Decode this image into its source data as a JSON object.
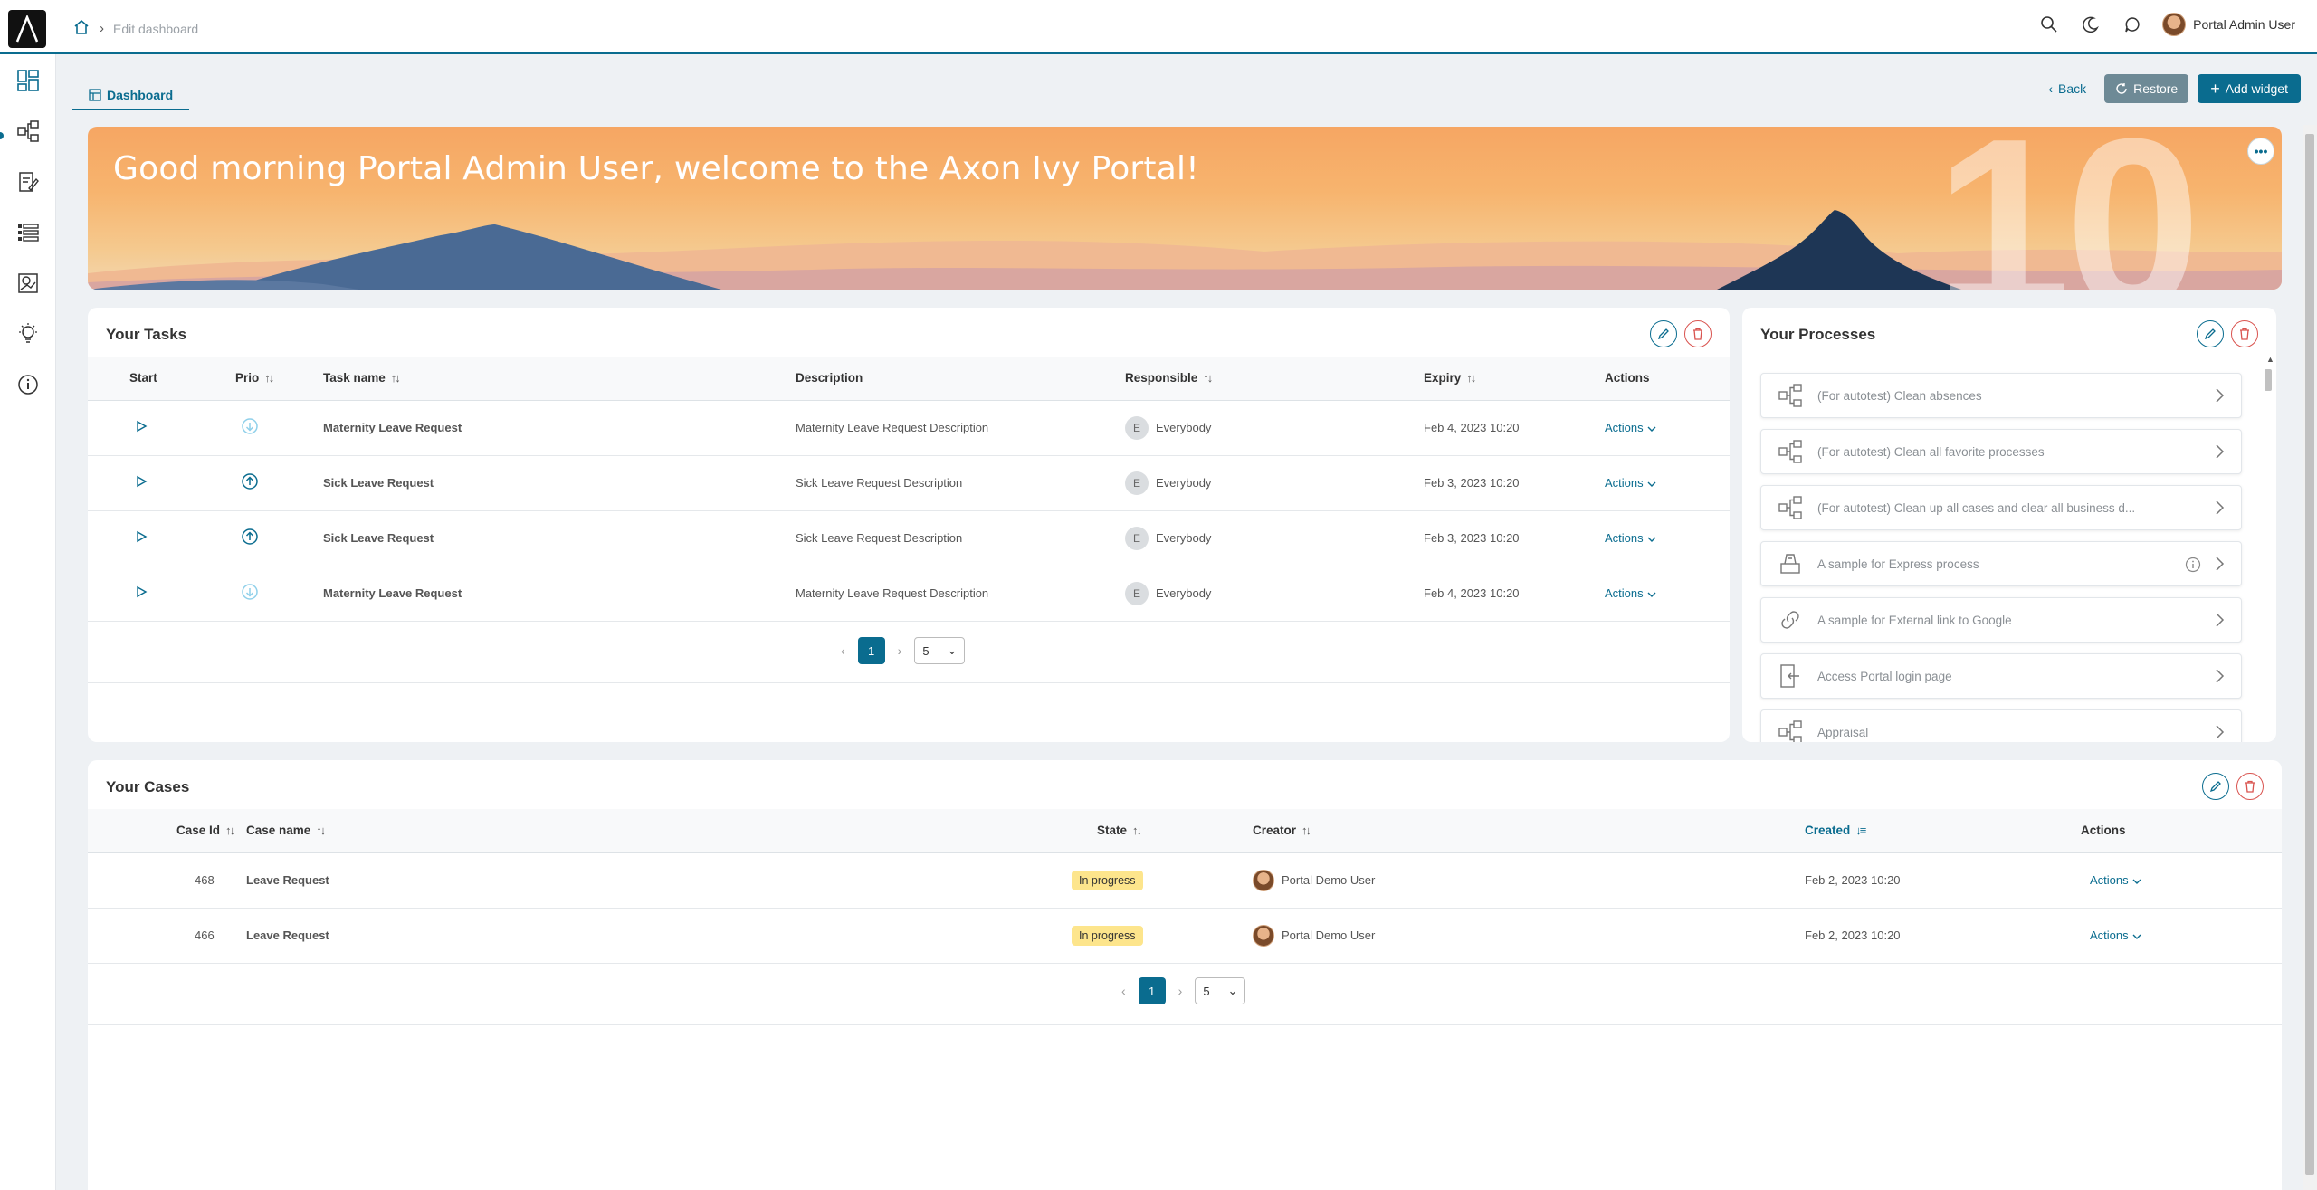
{
  "header": {
    "breadcrumb": "Edit dashboard",
    "user_name": "Portal Admin User"
  },
  "toolbar": {
    "tab_label": "Dashboard",
    "back_label": "Back",
    "restore_label": "Restore",
    "add_widget_label": "Add widget"
  },
  "banner": {
    "greeting": "Good morning Portal Admin User, welcome to the Axon Ivy Portal!",
    "version_mark": "10"
  },
  "tasks": {
    "title": "Your Tasks",
    "columns": [
      "Start",
      "Prio",
      "Task name",
      "Description",
      "Responsible",
      "Expiry",
      "Actions"
    ],
    "rows": [
      {
        "prio": "low",
        "name": "Maternity Leave Request",
        "description": "Maternity Leave Request Description",
        "responsible_initial": "E",
        "responsible": "Everybody",
        "expiry": "Feb 4, 2023 10:20",
        "actions": "Actions"
      },
      {
        "prio": "high",
        "name": "Sick Leave Request",
        "description": "Sick Leave Request Description",
        "responsible_initial": "E",
        "responsible": "Everybody",
        "expiry": "Feb 3, 2023 10:20",
        "actions": "Actions"
      },
      {
        "prio": "high",
        "name": "Sick Leave Request",
        "description": "Sick Leave Request Description",
        "responsible_initial": "E",
        "responsible": "Everybody",
        "expiry": "Feb 3, 2023 10:20",
        "actions": "Actions"
      },
      {
        "prio": "low",
        "name": "Maternity Leave Request",
        "description": "Maternity Leave Request Description",
        "responsible_initial": "E",
        "responsible": "Everybody",
        "expiry": "Feb 4, 2023 10:20",
        "actions": "Actions"
      }
    ],
    "page": "1",
    "page_size": "5"
  },
  "processes": {
    "title": "Your Processes",
    "items": [
      {
        "label": "(For autotest) Clean absences",
        "icon": "process-flow-icon"
      },
      {
        "label": "(For autotest) Clean all favorite processes",
        "icon": "process-flow-icon"
      },
      {
        "label": "(For autotest) Clean up all cases and clear all business d...",
        "icon": "process-flow-icon"
      },
      {
        "label": "A sample for Express process",
        "icon": "express-icon",
        "info": true
      },
      {
        "label": "A sample for External link to Google",
        "icon": "link-icon"
      },
      {
        "label": "Access Portal login page",
        "icon": "login-icon"
      },
      {
        "label": "Appraisal",
        "icon": "process-flow-icon"
      }
    ]
  },
  "cases": {
    "title": "Your Cases",
    "columns": [
      "Case Id",
      "Case name",
      "State",
      "Creator",
      "Created",
      "Actions"
    ],
    "rows": [
      {
        "id": "468",
        "name": "Leave Request",
        "state": "In progress",
        "creator": "Portal Demo User",
        "created": "Feb 2, 2023 10:20",
        "actions": "Actions"
      },
      {
        "id": "466",
        "name": "Leave Request",
        "state": "In progress",
        "creator": "Portal Demo User",
        "created": "Feb 2, 2023 10:20",
        "actions": "Actions"
      }
    ],
    "page": "1",
    "page_size": "5"
  },
  "colors": {
    "accent": "#0a6c8f",
    "danger": "#d9534f",
    "state_in_progress": "#fde58c"
  }
}
